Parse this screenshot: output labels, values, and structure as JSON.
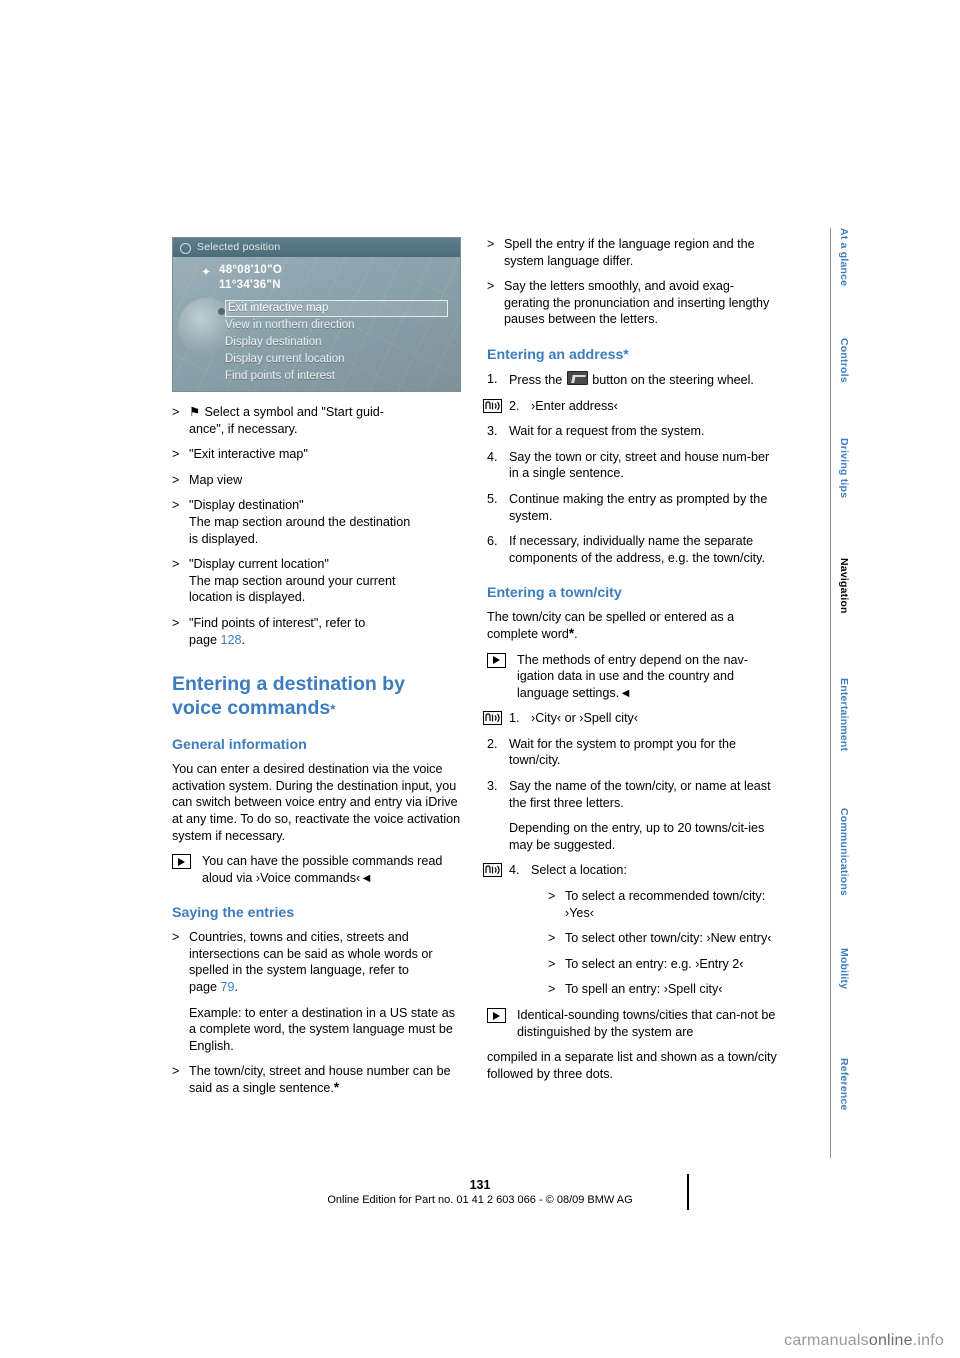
{
  "screenshot": {
    "header": "Selected position",
    "coord1": "48°08'10\"O",
    "coord2": "11°34'36\"N",
    "menu": [
      "Exit interactive map",
      "View in northern direction",
      "Display destination",
      "Display current location",
      "Find points of interest"
    ],
    "selected_index": 0
  },
  "left": {
    "bullets_top": [
      "Select a symbol and \"Start guid-\nance\", if necessary.",
      "\"Exit interactive map\"",
      "Map view",
      "\"Display destination\"\nThe map section around the destination\nis displayed.",
      "\"Display current location\"\nThe map section around your current\nlocation is displayed."
    ],
    "b1_icon": "compass-symbol",
    "poi_bullet_pre": "\"Find points of interest\", refer to",
    "poi_bullet_page_word": "page",
    "poi_bullet_page": "128",
    "poi_bullet_end": ".",
    "heading_main": "Entering a destination by\nvoice commands",
    "heading_main_star": "*",
    "heading_general": "General information",
    "general_p1": "You can enter a desired destination via the voice activation system. During the destination input, you can switch between voice entry and entry via iDrive at any time. To do so, reactivate the voice activation system if necessary.",
    "note_commands": "You can have the possible commands read aloud via ›Voice commands‹◄",
    "heading_saying": "Saying the entries",
    "bullet_countries_pre": "Countries, towns and cities, streets and intersections can be said as whole words or spelled in the system language, refer to",
    "bullet_countries_page_word": "page",
    "bullet_countries_page": "79",
    "bullet_countries_end": ".",
    "example_text": "Example: to enter a destination in a US state as a complete word, the system language must be English.",
    "bullet_townstreet": "The town/city, street and house number can be said as a single sentence.",
    "bullet_townstreet_star": "*"
  },
  "right": {
    "bullets_top": [
      "Spell the entry if the language region and the system language differ.",
      "Say the letters smoothly, and avoid exag-gerating the pronunciation and inserting lengthy pauses between the letters."
    ],
    "heading_address": "Entering an address",
    "heading_address_star": "*",
    "steps_address": [
      {
        "num": "1.",
        "text_pre": "Press the",
        "text_post": "button on the steering wheel.",
        "has_button": true
      },
      {
        "num": "2.",
        "text": "›Enter address‹",
        "voice": true
      },
      {
        "num": "3.",
        "text": "Wait for a request from the system."
      },
      {
        "num": "4.",
        "text": "Say the town or city, street and house num-ber in a single sentence."
      },
      {
        "num": "5.",
        "text": "Continue making the entry as prompted by the system."
      },
      {
        "num": "6.",
        "text": "If necessary, individually name the separate components of the address, e.g. the town/city."
      }
    ],
    "heading_town": "Entering a town/city",
    "town_p1_pre": "The town/city can be spelled or entered as a complete word",
    "town_p1_star": "*",
    "town_p1_end": ".",
    "note_methods": "The methods of entry depend on the nav-igation data in use and the country and language settings.◄",
    "steps_town": [
      {
        "num": "1.",
        "text": "›City‹ or ›Spell city‹",
        "voice": true
      },
      {
        "num": "2.",
        "text": "Wait for the system to prompt you for the town/city."
      },
      {
        "num": "3.",
        "text": "Say the name of the town/city, or name at least the first three letters."
      }
    ],
    "town_depend": "Depending on the entry, up to 20 towns/cit-ies may be suggested.",
    "step4": {
      "num": "4.",
      "text": "Select a location:",
      "voice": true
    },
    "step4_bullets": [
      "To select a recommended town/city: ›Yes‹",
      "To select other town/city: ›New entry‹",
      "To select an entry: e.g. ›Entry 2‹",
      "To spell an entry: ›Spell city‹"
    ],
    "note_identical": "Identical-sounding towns/cities that can-not be distinguished by the system are",
    "note_identical_cont": "compiled in a separate list and shown as a town/city followed by three dots."
  },
  "sidetabs": [
    {
      "label": "At a glance",
      "active": false
    },
    {
      "label": "Controls",
      "active": false
    },
    {
      "label": "Driving tips",
      "active": false
    },
    {
      "label": "Navigation",
      "active": true
    },
    {
      "label": "Entertainment",
      "active": false
    },
    {
      "label": "Communications",
      "active": false
    },
    {
      "label": "Mobility",
      "active": false
    },
    {
      "label": "Reference",
      "active": false
    }
  ],
  "footer": {
    "page_number": "131",
    "edition": "Online Edition for Part no. 01 41 2 603 066 - © 08/09 BMW AG"
  },
  "watermark": {
    "part1": "carmanuals",
    "part2": "online",
    "part3": ".info"
  },
  "colors": {
    "accent": "#3c7cbf",
    "tab_inactive": "#3c7cbf",
    "tab_active": "#000000"
  }
}
